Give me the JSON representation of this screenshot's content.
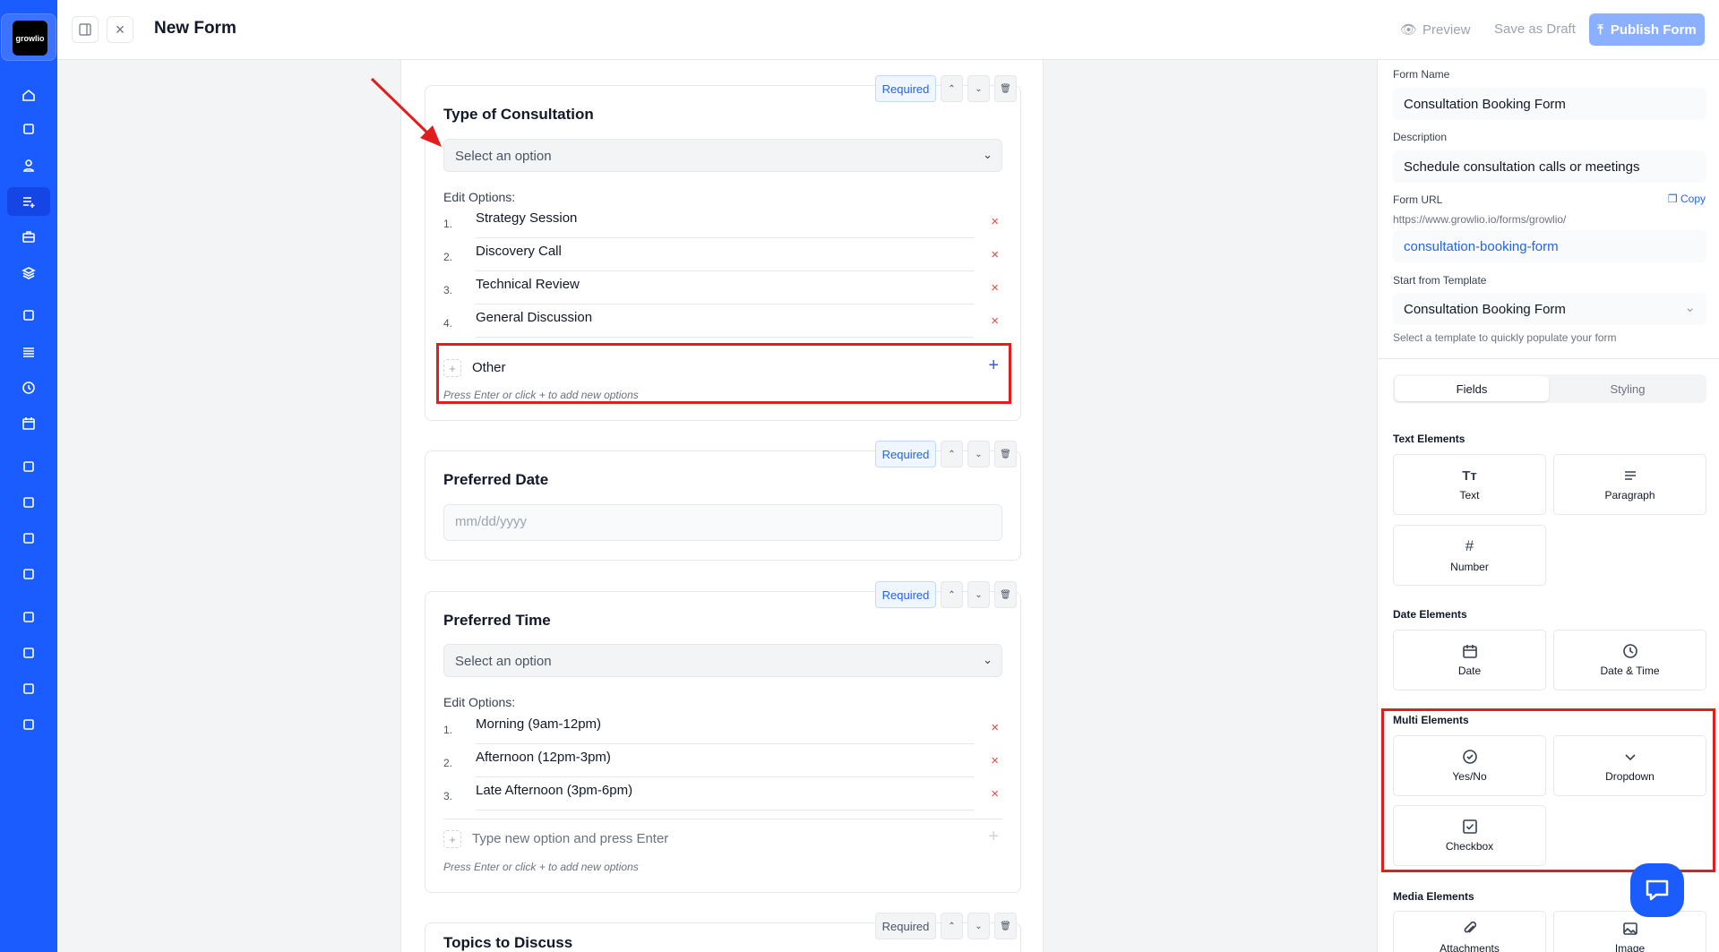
{
  "app": {
    "logo_text": "growlio"
  },
  "sidebar": {
    "items": [
      {
        "icon": "home-icon"
      },
      {
        "icon": "team-icon"
      },
      {
        "icon": "user-icon"
      },
      {
        "icon": "form-add-icon",
        "active": true
      },
      {
        "icon": "briefcase-icon"
      },
      {
        "icon": "layers-icon"
      },
      {
        "icon": "bag-icon"
      },
      {
        "icon": "list-icon"
      },
      {
        "icon": "clock-icon"
      },
      {
        "icon": "calendar-icon"
      },
      {
        "icon": "basket-icon"
      },
      {
        "icon": "receipt-icon"
      },
      {
        "icon": "money-icon"
      },
      {
        "icon": "coins-icon"
      },
      {
        "icon": "report-icon"
      },
      {
        "icon": "pie-chart-icon"
      },
      {
        "icon": "bar-chart-icon"
      },
      {
        "icon": "user-list-icon"
      }
    ]
  },
  "header": {
    "title": "New Form",
    "preview": "Preview",
    "save_draft": "Save as Draft",
    "publish": "Publish Form"
  },
  "cards": [
    {
      "title": "Type of Consultation",
      "required": "Required",
      "required_active": true,
      "select_placeholder": "Select an option",
      "edit_label": "Edit Options:",
      "options": [
        "Strategy Session",
        "Discovery Call",
        "Technical Review",
        "General Discussion"
      ],
      "new_option_value": "Other",
      "hint": "Press Enter or click + to add new options"
    },
    {
      "title": "Preferred Date",
      "required": "Required",
      "required_active": true,
      "date_placeholder": "mm/dd/yyyy"
    },
    {
      "title": "Preferred Time",
      "required": "Required",
      "required_active": true,
      "select_placeholder": "Select an option",
      "edit_label": "Edit Options:",
      "options": [
        "Morning (9am-12pm)",
        "Afternoon (12pm-3pm)",
        "Late Afternoon (3pm-6pm)"
      ],
      "new_option_placeholder": "Type new option and press Enter",
      "hint": "Press Enter or click + to add new options"
    },
    {
      "title": "Topics to Discuss",
      "required": "Required",
      "required_active": false
    }
  ],
  "panel": {
    "form_name_label": "Form Name",
    "form_name": "Consultation Booking Form",
    "description_label": "Description",
    "description": "Schedule consultation calls or meetings",
    "url_label": "Form URL",
    "copy": "Copy",
    "url_prefix": "https://www.growlio.io/forms/growlio/",
    "url_slug": "consultation-booking-form",
    "template_label": "Start from Template",
    "template": "Consultation Booking Form",
    "template_help": "Select a template to quickly populate your form",
    "tabs": [
      "Fields",
      "Styling"
    ],
    "text_elements": "Text Elements",
    "text_tiles": [
      "Text",
      "Paragraph",
      "Number"
    ],
    "date_elements": "Date Elements",
    "date_tiles": [
      "Date",
      "Date & Time"
    ],
    "multi_elements": "Multi Elements",
    "multi_tiles": [
      "Yes/No",
      "Dropdown",
      "Checkbox"
    ],
    "media_elements": "Media Elements",
    "media_tiles": [
      "Attachments",
      "Image"
    ]
  },
  "colors": {
    "brand": "#1a5cff",
    "required": "#2563eb",
    "delete": "#ef4444",
    "annotation": "#e11d1d"
  }
}
